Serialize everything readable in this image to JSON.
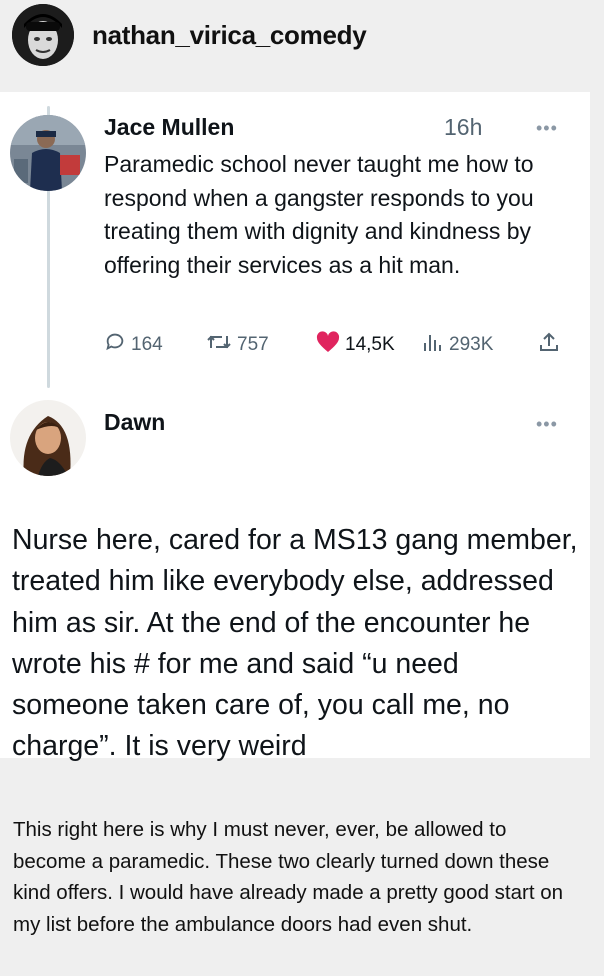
{
  "header": {
    "username": "nathan_virica_comedy"
  },
  "tweet": {
    "author": "Jace Mullen",
    "time": "16h",
    "text": "Paramedic school never taught me how to respond when a gangster responds to you treating them with dignity and kindness by offering their services as a hit man.",
    "stats": {
      "replies": "164",
      "retweets": "757",
      "likes": "14,5K",
      "views": "293K"
    }
  },
  "reply": {
    "author": "Dawn",
    "text": "Nurse here, cared for a MS13 gang member, treated him like everybody else, addressed him as sir. At the end of the encounter he wrote his # for me and said “u need someone taken care of, you call me, no charge”. It is very weird"
  },
  "caption": "This right here is why I must never, ever, be allowed to become a paramedic. These two clearly turned down these kind offers. I would have already made a pretty good start on my list before the ambulance doors had even shut.",
  "icons": {
    "more": "more-options-icon",
    "reply": "reply-icon",
    "retweet": "retweet-icon",
    "like": "heart-icon",
    "views": "views-icon",
    "share": "share-icon"
  },
  "colors": {
    "like": "#e0245e",
    "muted": "#536471",
    "background": "#efefef"
  }
}
